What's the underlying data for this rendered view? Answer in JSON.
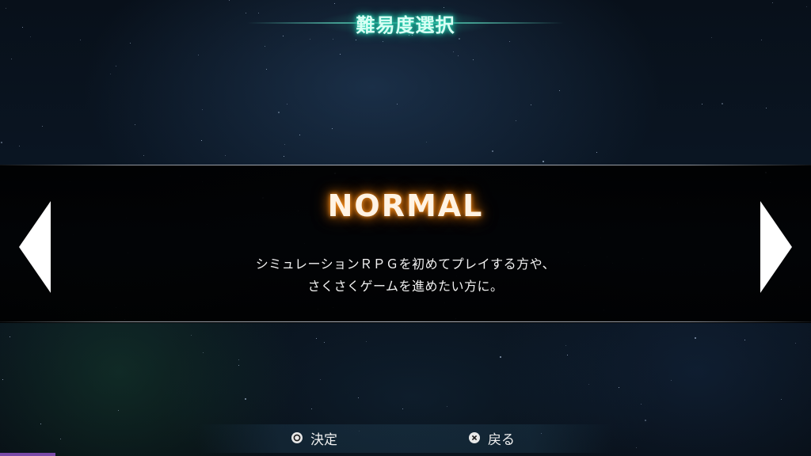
{
  "header": {
    "title": "難易度選択"
  },
  "selection": {
    "difficulty": "NORMAL",
    "description_line1": "シミュレーションＲＰＧを初めてプレイする方や、",
    "description_line2": "さくさくゲームを進めたい方に。"
  },
  "footer": {
    "confirm_label": "決定",
    "confirm_icon": "circle-button-icon",
    "back_label": "戻る",
    "back_icon": "cross-button-icon"
  },
  "colors": {
    "title_glow": "#2fe0c0",
    "difficulty_glow": "#ff9a2a",
    "arrow": "#ffffff"
  }
}
